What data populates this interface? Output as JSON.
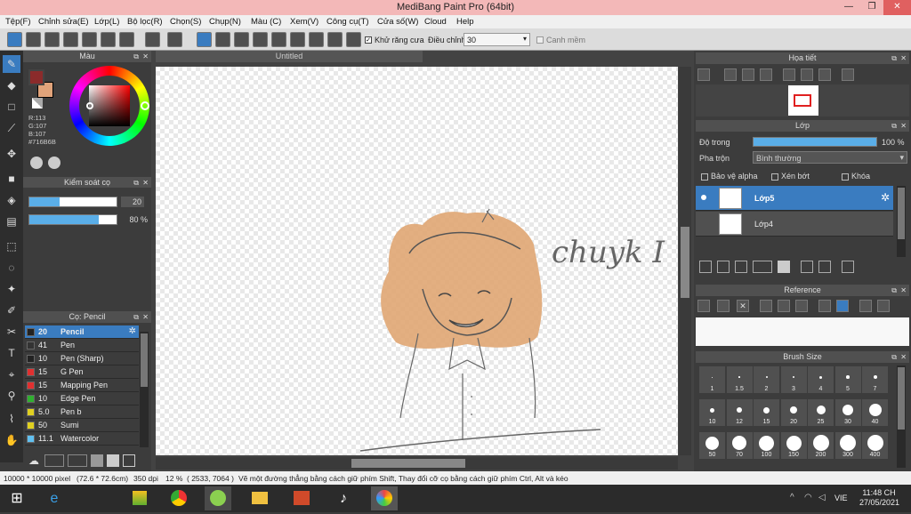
{
  "window": {
    "title": "MediBang Paint Pro (64bit)"
  },
  "menu": [
    "Tệp(F)",
    "Chỉnh sửa(E)",
    "Lớp(L)",
    "Bộ lọc(R)",
    "Chọn(S)",
    "Chụp(N)",
    "Màu (C)",
    "Xem(V)",
    "Công cụ(T)",
    "Cửa số(W)",
    "Cloud",
    "Help"
  ],
  "toolbar": {
    "antialias_label": "Khử răng cưa",
    "adjust_label": "Điều chỉnh",
    "adjust_value": "30",
    "edge_label": "Canh mềm"
  },
  "color_panel": {
    "title": "Màu",
    "r": "R:113",
    "g": "G:107",
    "b": "B:107",
    "hex": "#716B6B",
    "fg": "#8b2b2b",
    "bg": "#e0a37a"
  },
  "brush_control": {
    "title": "Kiểm soát cọ",
    "size_value": "20",
    "opacity_value": "80 %",
    "size_fill": 0.35,
    "opacity_fill": 0.8
  },
  "brush_panel": {
    "title": "Cọ: Pencil",
    "items": [
      {
        "size": "20",
        "name": "Pencil",
        "color": "#222222"
      },
      {
        "size": "41",
        "name": "Pen",
        "color": "#333333"
      },
      {
        "size": "10",
        "name": "Pen (Sharp)",
        "color": "#222222"
      },
      {
        "size": "15",
        "name": "G Pen",
        "color": "#e03030"
      },
      {
        "size": "15",
        "name": "Mapping Pen",
        "color": "#e03030"
      },
      {
        "size": "10",
        "name": "Edge Pen",
        "color": "#30b030"
      },
      {
        "size": "5.0",
        "name": "Pen b",
        "color": "#e0d020"
      },
      {
        "size": "50",
        "name": "Sumi",
        "color": "#e0d020"
      },
      {
        "size": "11.1",
        "name": "Watercolor",
        "color": "#60c0f0"
      }
    ]
  },
  "canvas": {
    "tab": "Untitled",
    "signature": "chuyk I"
  },
  "navigator": {
    "title": "Họa tiết"
  },
  "layer_panel": {
    "title": "Lớp",
    "opacity_label": "Độ trong",
    "opacity_value": "100 %",
    "opacity_fill": 1.0,
    "blend_label": "Pha trộn",
    "blend_value": "Bình thường",
    "protect_alpha": "Bảo vệ alpha",
    "clipping": "Xén bớt",
    "lock": "Khóa",
    "layers": [
      "Lớp5",
      "Lớp4"
    ]
  },
  "reference": {
    "title": "Reference"
  },
  "brush_size": {
    "title": "Brush Size",
    "sizes": [
      "1",
      "1.5",
      "2",
      "3",
      "4",
      "5",
      "7",
      "10",
      "12",
      "15",
      "20",
      "25",
      "30",
      "40",
      "50",
      "70",
      "100",
      "150",
      "200",
      "300",
      "400"
    ]
  },
  "status": {
    "canvas_size": "10000 * 10000 pixel",
    "dims": "(72.6 * 72.6cm)",
    "dpi": "350 dpi",
    "zoom": "12 %",
    "coords": "( 2533, 7064 )",
    "hint": "Vẽ một đường thẳng bằng cách giữ phím Shift, Thay đổi cỡ cọ bằng cách giữ phím Ctrl, Alt và kéo"
  },
  "taskbar": {
    "lang": "VIE",
    "time": "11:48 CH",
    "date": "27/05/2021"
  }
}
